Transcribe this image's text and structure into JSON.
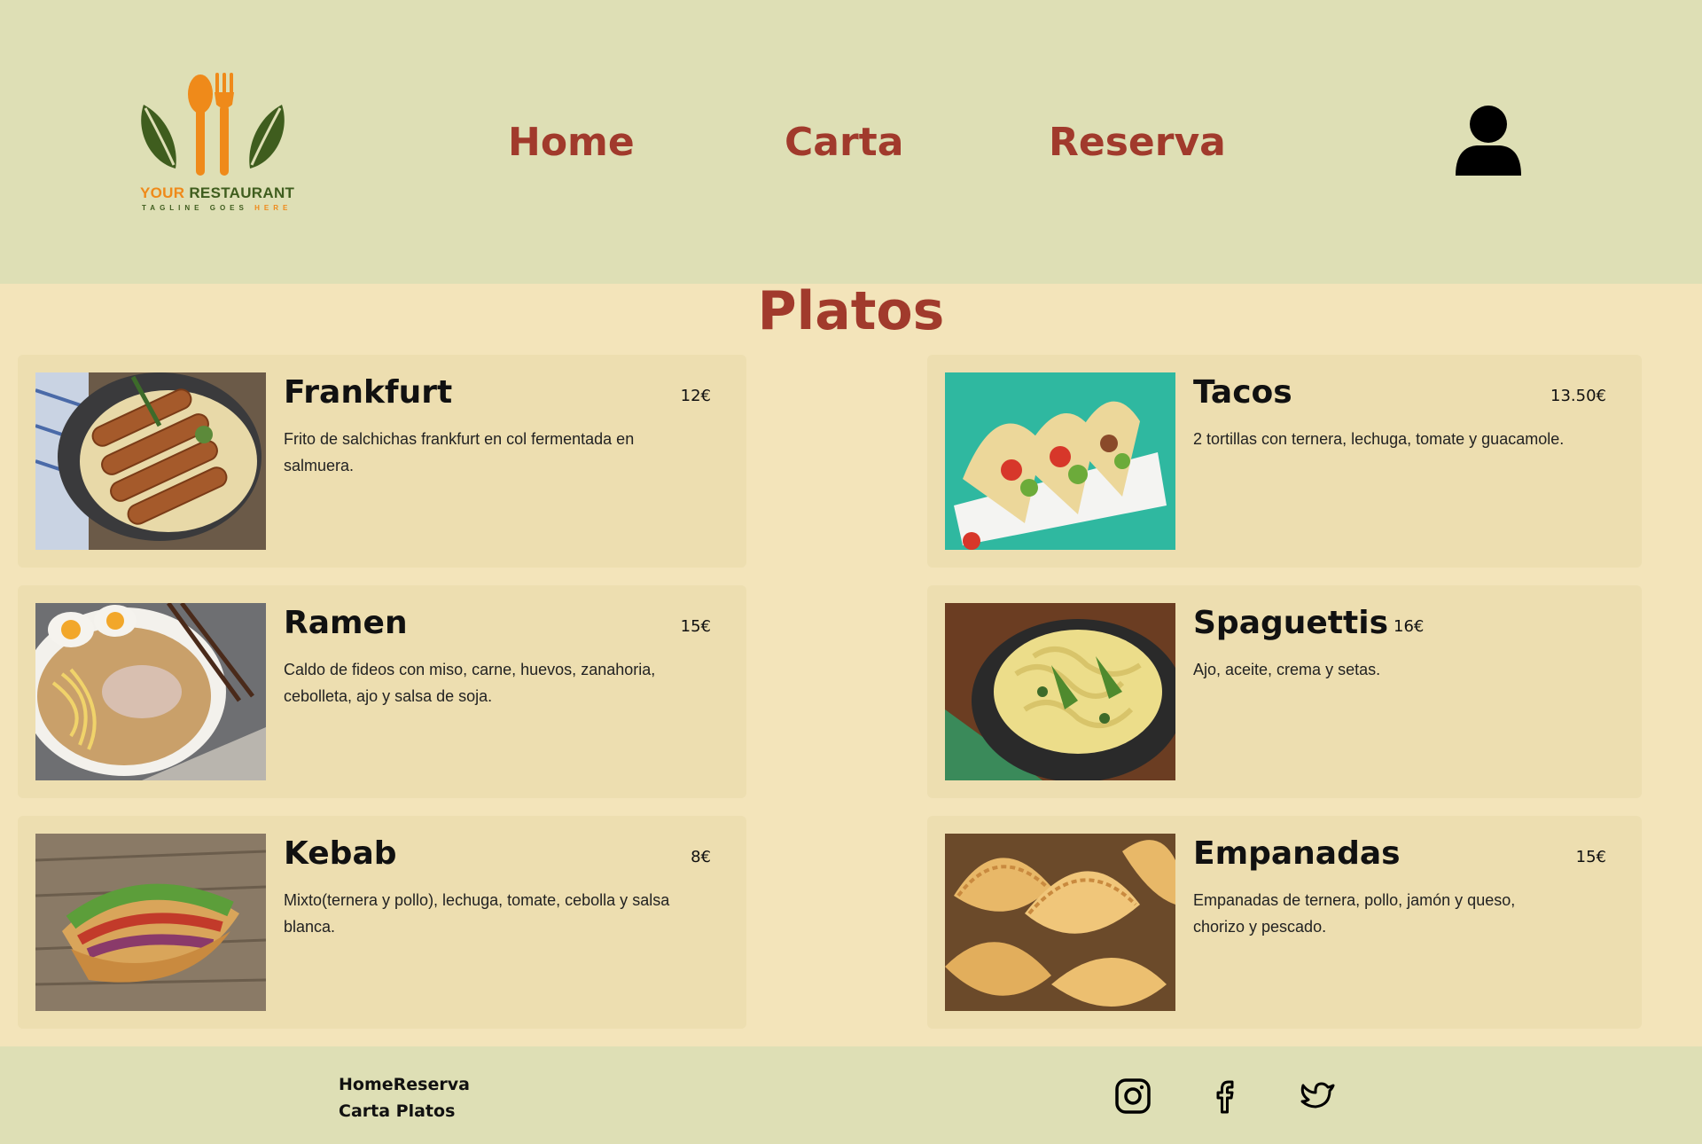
{
  "header": {
    "logo": {
      "brand_first": "YOUR",
      "brand_second": "RESTAURANT",
      "tagline_main": "TAGLINE GOES",
      "tagline_end": "HERE",
      "icon": "restaurant-logo-icon"
    },
    "nav": {
      "home": "Home",
      "carta": "Carta",
      "reserva": "Reserva"
    },
    "user_icon": "user-icon"
  },
  "main": {
    "title": "Platos",
    "dishes": [
      {
        "name": "Frankfurt",
        "price": "12€",
        "description": "Frito de salchichas frankfurt en col fermentada en salmuera."
      },
      {
        "name": "Tacos",
        "price": "13.50€",
        "description": "2 tortillas con ternera, lechuga, tomate y guacamole."
      },
      {
        "name": "Ramen",
        "price": "15€",
        "description": "Caldo de fideos con miso, carne, huevos, zanahoria, cebolleta, ajo y salsa de soja."
      },
      {
        "name": "Spaguettis",
        "price": "16€",
        "description": "Ajo, aceite, crema y setas."
      },
      {
        "name": "Kebab",
        "price": "8€",
        "description": "Mixto(ternera y pollo), lechuga, tomate, cebolla y salsa blanca."
      },
      {
        "name": "Empanadas",
        "price": "15€",
        "description": "Empanadas de ternera, pollo, jamón y queso, chorizo y pescado."
      }
    ]
  },
  "footer": {
    "link_home": "Home",
    "link_reserva": "Reserva",
    "link_carta": "Carta",
    "link_platos": "Platos",
    "social": [
      "instagram-icon",
      "facebook-icon",
      "twitter-icon"
    ]
  },
  "colors": {
    "header_bg": "#dedfb5",
    "page_bg": "#f3e4ba",
    "card_bg": "#eddeb0",
    "accent": "#a13a2c",
    "logo_orange": "#ef8a1a",
    "logo_green": "#3f5d1e"
  }
}
